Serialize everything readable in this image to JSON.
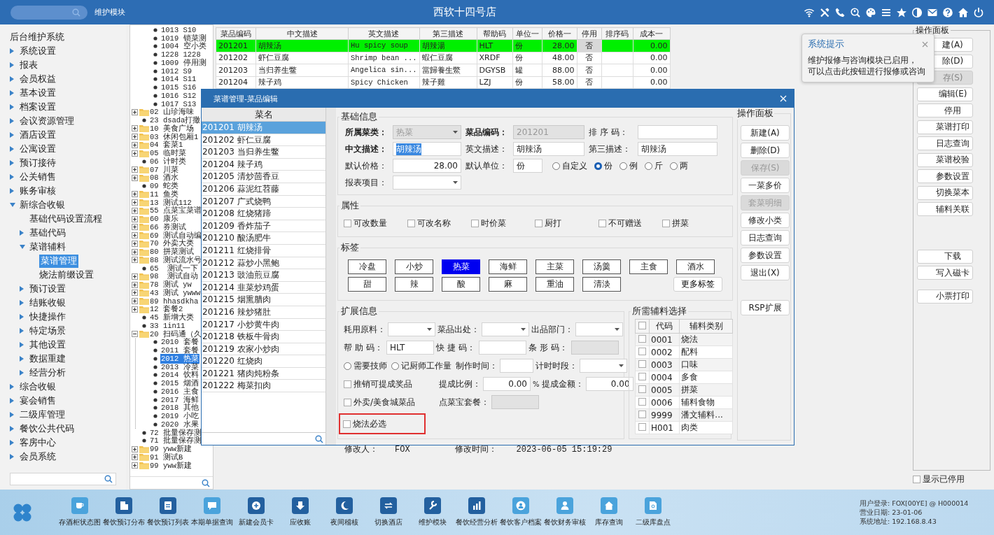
{
  "top_bar": {
    "module_label": "维护模块",
    "title": "西软十四号店"
  },
  "sidebar": {
    "title": "后台维护系统",
    "items": [
      {
        "label": "系统设置",
        "kind": "branch",
        "expanded": false,
        "selected": false
      },
      {
        "label": "报表",
        "kind": "branch",
        "expanded": false,
        "selected": false
      },
      {
        "label": "会员权益",
        "kind": "branch",
        "expanded": false,
        "selected": false
      },
      {
        "label": "基本设置",
        "kind": "branch",
        "expanded": false,
        "selected": false
      },
      {
        "label": "档案设置",
        "kind": "branch",
        "expanded": false,
        "selected": false
      },
      {
        "label": "会议资源管理",
        "kind": "branch",
        "expanded": false,
        "selected": false
      },
      {
        "label": "酒店设置",
        "kind": "branch",
        "expanded": false,
        "selected": false
      },
      {
        "label": "公寓设置",
        "kind": "branch",
        "expanded": false,
        "selected": false
      },
      {
        "label": "预订接待",
        "kind": "branch",
        "expanded": false,
        "selected": false
      },
      {
        "label": "公关销售",
        "kind": "branch",
        "expanded": false,
        "selected": false
      },
      {
        "label": "账务审核",
        "kind": "branch",
        "expanded": false,
        "selected": false
      },
      {
        "label": "新综合收银",
        "kind": "branch",
        "expanded": true,
        "selected": false,
        "children": [
          {
            "label": "基础代码设置流程",
            "kind": "leaf",
            "selected": false
          },
          {
            "label": "基础代码",
            "kind": "branch",
            "expanded": false,
            "selected": false
          },
          {
            "label": "菜谱辅料",
            "kind": "branch",
            "expanded": true,
            "selected": false,
            "children": [
              {
                "label": "菜谱管理",
                "kind": "leaf",
                "selected": true
              },
              {
                "label": "烧法前缀设置",
                "kind": "leaf",
                "selected": false
              }
            ]
          },
          {
            "label": "预订设置",
            "kind": "branch",
            "expanded": false,
            "selected": false
          },
          {
            "label": "结账收银",
            "kind": "branch",
            "expanded": false,
            "selected": false
          },
          {
            "label": "快捷操作",
            "kind": "branch",
            "expanded": false,
            "selected": false
          },
          {
            "label": "特定场景",
            "kind": "branch",
            "expanded": false,
            "selected": false
          },
          {
            "label": "其他设置",
            "kind": "branch",
            "expanded": false,
            "selected": false
          },
          {
            "label": "数据重建",
            "kind": "branch",
            "expanded": false,
            "selected": false
          },
          {
            "label": "经营分析",
            "kind": "branch",
            "expanded": false,
            "selected": false
          }
        ]
      },
      {
        "label": "综合收银",
        "kind": "branch",
        "expanded": false,
        "selected": false
      },
      {
        "label": "宴会销售",
        "kind": "branch",
        "expanded": false,
        "selected": false
      },
      {
        "label": "二级库管理",
        "kind": "branch",
        "expanded": false,
        "selected": false
      },
      {
        "label": "餐饮公共代码",
        "kind": "branch",
        "expanded": false,
        "selected": false
      },
      {
        "label": "客房中心",
        "kind": "branch",
        "expanded": false,
        "selected": false
      },
      {
        "label": "会员系统",
        "kind": "branch",
        "expanded": false,
        "selected": false
      }
    ]
  },
  "tree": {
    "partial_branch": {
      "children": [
        {
          "label": "1013 S10",
          "kind": "leaf",
          "selected": false
        },
        {
          "label": "1019 锁菜测",
          "kind": "leaf",
          "selected": false
        },
        {
          "label": "1004 空小类",
          "kind": "leaf",
          "selected": false
        },
        {
          "label": "1228 1228",
          "kind": "leaf",
          "selected": false
        },
        {
          "label": "1009 停用测",
          "kind": "leaf",
          "selected": false
        },
        {
          "label": "1012 S9",
          "kind": "leaf",
          "selected": false
        },
        {
          "label": "1014 S11",
          "kind": "leaf",
          "selected": false
        },
        {
          "label": "1015 S16",
          "kind": "leaf",
          "selected": false
        },
        {
          "label": "1016 S12",
          "kind": "leaf",
          "selected": false
        },
        {
          "label": "1017 S13",
          "kind": "leaf",
          "selected": false
        }
      ]
    },
    "items": [
      {
        "label": "02 山珍海味",
        "kind": "folder",
        "expanded": false,
        "selected": false
      },
      {
        "label": "23 dsada打撤",
        "kind": "leaf",
        "selected": false
      },
      {
        "label": "10 美食广场",
        "kind": "folder",
        "expanded": false,
        "selected": false
      },
      {
        "label": "03 休闲包厢1",
        "kind": "folder",
        "expanded": false,
        "selected": false
      },
      {
        "label": "04 套菜1",
        "kind": "folder",
        "expanded": false,
        "selected": false
      },
      {
        "label": "05 临时菜",
        "kind": "folder",
        "expanded": false,
        "selected": false
      },
      {
        "label": "06 计时类",
        "kind": "leaf",
        "selected": false
      },
      {
        "label": "07 川菜",
        "kind": "folder",
        "expanded": false,
        "selected": false
      },
      {
        "label": "08 酒水",
        "kind": "folder",
        "expanded": false,
        "selected": false
      },
      {
        "label": "09 蛇类",
        "kind": "leaf",
        "selected": false
      },
      {
        "label": "11 鱼类",
        "kind": "folder",
        "expanded": false,
        "selected": false
      },
      {
        "label": "13 测试112",
        "kind": "folder",
        "expanded": false,
        "selected": false
      },
      {
        "label": "55 点菜宝菜谱",
        "kind": "folder",
        "expanded": false,
        "selected": false
      },
      {
        "label": "60 康乐",
        "kind": "folder",
        "expanded": false,
        "selected": false
      },
      {
        "label": "66 券测试",
        "kind": "folder",
        "expanded": false,
        "selected": false
      },
      {
        "label": "69 测试自动编",
        "kind": "folder",
        "expanded": false,
        "selected": false
      },
      {
        "label": "70 外卖大类",
        "kind": "folder",
        "expanded": false,
        "selected": false
      },
      {
        "label": "80 拼菜测试",
        "kind": "folder",
        "expanded": false,
        "selected": false
      },
      {
        "label": "88 测试流水号",
        "kind": "folder",
        "expanded": false,
        "selected": false
      },
      {
        "label": "65  测试一下",
        "kind": "leaf",
        "selected": false
      },
      {
        "label": "98  测试自动",
        "kind": "folder",
        "expanded": false,
        "selected": false
      },
      {
        "label": "78 测试 yw",
        "kind": "folder",
        "expanded": false,
        "selected": false
      },
      {
        "label": "43 测试 ywww",
        "kind": "folder",
        "expanded": false,
        "selected": false
      },
      {
        "label": "89 hhasdkha",
        "kind": "folder",
        "expanded": false,
        "selected": false
      },
      {
        "label": "12 套餐2",
        "kind": "folder",
        "expanded": false,
        "selected": false
      },
      {
        "label": "45 新增大类",
        "kind": "leaf",
        "selected": false
      },
      {
        "label": "33 1in11",
        "kind": "leaf",
        "selected": false
      },
      {
        "label": "20 扫码通（久",
        "kind": "folder",
        "expanded": true,
        "selected": false,
        "children": [
          {
            "label": "2010 套餐",
            "kind": "leaf",
            "selected": false
          },
          {
            "label": "2011 套餐",
            "kind": "leaf",
            "selected": false
          },
          {
            "label": "2012 热菜",
            "kind": "leaf",
            "selected": true
          },
          {
            "label": "2013 冷菜",
            "kind": "leaf",
            "selected": false
          },
          {
            "label": "2014 饮料",
            "kind": "leaf",
            "selected": false
          },
          {
            "label": "2015 烟酒",
            "kind": "leaf",
            "selected": false
          },
          {
            "label": "2016 主食",
            "kind": "leaf",
            "selected": false
          },
          {
            "label": "2017 海鲜",
            "kind": "leaf",
            "selected": false
          },
          {
            "label": "2018 其他",
            "kind": "leaf",
            "selected": false
          },
          {
            "label": "2019 小吃",
            "kind": "leaf",
            "selected": false
          },
          {
            "label": "2020 水果",
            "kind": "leaf",
            "selected": false
          }
        ]
      },
      {
        "label": "72 批量保存测",
        "kind": "leaf",
        "selected": false
      },
      {
        "label": "71 批量保存测",
        "kind": "leaf",
        "selected": false
      },
      {
        "label": "99 yww新建",
        "kind": "folder",
        "expanded": false,
        "selected": false
      },
      {
        "label": "91 测试B",
        "kind": "folder",
        "expanded": false,
        "selected": false
      },
      {
        "label": "99 yww新建",
        "kind": "folder",
        "expanded": false,
        "selected": false
      }
    ]
  },
  "dish_table": {
    "columns": [
      "菜品编码",
      "中文描述",
      "英文描述",
      "第三描述",
      "帮助码",
      "单位一",
      "价格一",
      "停用",
      "排序码",
      "成本一"
    ],
    "rows": [
      {
        "selected": true,
        "cells": [
          "201201",
          "胡辣汤",
          "Hu spicy soup",
          "胡辣湯",
          "HLT",
          "份",
          "28.00",
          "否",
          "",
          "0.00"
        ]
      },
      {
        "selected": false,
        "cells": [
          "201202",
          "虾仁豆腐",
          "Shrimp bean ...",
          "蝦仁豆腐",
          "XRDF",
          "份",
          "48.00",
          "否",
          "",
          "0.00"
        ]
      },
      {
        "selected": false,
        "cells": [
          "201203",
          "当归养生鳖",
          "Angelica sin...",
          "當歸養生鱉",
          "DGYSB",
          "罐",
          "88.00",
          "否",
          "",
          "0.00"
        ]
      },
      {
        "selected": false,
        "cells": [
          "201204",
          "辣子鸡",
          "Spicy Chicken",
          "辣子雞",
          "LZJ",
          "份",
          "58.00",
          "否",
          "",
          "0.00"
        ]
      }
    ]
  },
  "tooltip": {
    "title": "系统提示",
    "lines": [
      "维护报修与咨询模块已启用，",
      "可以点击此按钮进行报修或咨询"
    ]
  },
  "operation_panel": {
    "title": "操作面板",
    "groups": [
      {
        "buttons": [
          {
            "label": "建(A)",
            "disabled": false
          },
          {
            "label": "除(D)",
            "disabled": false
          },
          {
            "label": "存(S)",
            "disabled": true
          },
          {
            "label": "编辑(E)",
            "disabled": false
          },
          {
            "label": "停用",
            "disabled": false
          },
          {
            "label": "菜谱打印",
            "disabled": false
          },
          {
            "label": "日志查询",
            "disabled": false
          },
          {
            "label": "菜谱校验",
            "disabled": false
          },
          {
            "label": "参数设置",
            "disabled": false
          },
          {
            "label": "切换菜本",
            "disabled": false
          },
          {
            "label": "辅料关联",
            "disabled": false
          }
        ]
      },
      {
        "buttons": [
          {
            "label": "下载",
            "disabled": false
          },
          {
            "label": "写入磁卡",
            "disabled": false
          }
        ]
      },
      {
        "buttons": [
          {
            "label": "小票打印",
            "disabled": false
          }
        ]
      }
    ],
    "show_disabled": {
      "label": "显示已停用",
      "checked": false
    }
  },
  "dialog": {
    "title": "菜谱管理-菜品编辑",
    "dish_list": {
      "header": "菜名",
      "rows": [
        {
          "label": "201201 胡辣汤",
          "selected": true
        },
        {
          "label": "201202 虾仁豆腐",
          "selected": false
        },
        {
          "label": "201203 当归养生鳖",
          "selected": false
        },
        {
          "label": "201204 辣子鸡",
          "selected": false
        },
        {
          "label": "201205 清炒茴香豆",
          "selected": false
        },
        {
          "label": "201206 蒜泥红苕藤",
          "selected": false
        },
        {
          "label": "201207 广式烧鸭",
          "selected": false
        },
        {
          "label": "201208 红烧猪蹄",
          "selected": false
        },
        {
          "label": "201209 香炸茄子",
          "selected": false
        },
        {
          "label": "201210 酸汤肥牛",
          "selected": false
        },
        {
          "label": "201211 红烧排骨",
          "selected": false
        },
        {
          "label": "201212 蒜炒小黑鲍",
          "selected": false
        },
        {
          "label": "201213 豉油煎豆腐",
          "selected": false
        },
        {
          "label": "201214 韭菜炒鸡蛋",
          "selected": false
        },
        {
          "label": "201215 烟熏腊肉",
          "selected": false
        },
        {
          "label": "201216 辣炒猪肚",
          "selected": false
        },
        {
          "label": "201217 小炒黄牛肉",
          "selected": false
        },
        {
          "label": "201218 铁板牛骨肉",
          "selected": false
        },
        {
          "label": "201219 农家小炒肉",
          "selected": false
        },
        {
          "label": "201220 红烧肉",
          "selected": false
        },
        {
          "label": "201221 猪肉炖粉条",
          "selected": false
        },
        {
          "label": "201222 梅菜扣肉",
          "selected": false
        }
      ]
    },
    "basic_info": {
      "title": "基础信息",
      "rows": [
        [
          {
            "kind": "label",
            "text": "所属菜类：",
            "bold": true
          },
          {
            "kind": "select",
            "value": "热菜",
            "disabled": true
          },
          {
            "kind": "label",
            "text": "菜品编码：",
            "bold": true
          },
          {
            "kind": "text",
            "value": "201201",
            "disabled": true
          },
          {
            "kind": "label",
            "text": "排 序 码：",
            "bold": false
          },
          {
            "kind": "text",
            "disabled": false
          }
        ],
        [
          {
            "kind": "label",
            "text": "中文描述：",
            "bold": true
          },
          {
            "kind": "text",
            "value": "胡辣汤",
            "disabled": false,
            "text_selected": true
          },
          {
            "kind": "label",
            "text": "英文描述：",
            "bold": false
          },
          {
            "kind": "text",
            "value": "胡辣汤",
            "disabled": false
          },
          {
            "kind": "label",
            "text": "第三描述：",
            "bold": false
          },
          {
            "kind": "text",
            "value": "胡辣汤",
            "disabled": false
          }
        ],
        [
          {
            "kind": "label",
            "text": "默认价格：",
            "bold": false
          },
          {
            "kind": "number",
            "value": "28.00",
            "disabled": false
          },
          {
            "kind": "label",
            "text": "默认单位：",
            "bold": false
          },
          {
            "kind": "unit_group",
            "value": "份",
            "disabled": false,
            "options": [
              {
                "label": "自定义",
                "selected": false
              },
              {
                "label": "份",
                "selected": true
              },
              {
                "label": "例",
                "selected": false
              },
              {
                "label": "斤",
                "selected": false
              },
              {
                "label": "两",
                "selected": false
              }
            ]
          }
        ],
        [
          {
            "kind": "label",
            "text": "报表项目：",
            "bold": false
          },
          {
            "kind": "select",
            "disabled": false
          }
        ]
      ]
    },
    "attributes": {
      "title": "属性",
      "options": [
        {
          "label": "可改数量",
          "checked": false
        },
        {
          "label": "可改名称",
          "checked": false
        },
        {
          "label": "时价菜",
          "checked": false
        },
        {
          "label": "厨打",
          "checked": false
        },
        {
          "label": "不可赠送",
          "checked": false
        },
        {
          "label": "拼菜",
          "checked": false
        }
      ]
    },
    "tags": {
      "title": "标签",
      "rows": [
        [
          {
            "label": "冷盘",
            "selected": false
          },
          {
            "label": "小炒",
            "selected": false
          },
          {
            "label": "热菜",
            "selected": true
          },
          {
            "label": "海鲜",
            "selected": false
          },
          {
            "label": "主菜",
            "selected": false
          },
          {
            "label": "汤羹",
            "selected": false
          },
          {
            "label": "主食",
            "selected": false
          },
          {
            "label": "酒水",
            "selected": false
          }
        ],
        [
          {
            "label": "甜",
            "selected": false
          },
          {
            "label": "辣",
            "selected": false
          },
          {
            "label": "酸",
            "selected": false
          },
          {
            "label": "麻",
            "selected": false
          },
          {
            "label": "重油",
            "selected": false
          },
          {
            "label": "清淡",
            "selected": false
          }
        ]
      ],
      "more_button": "更多标签"
    },
    "extended_info": {
      "title": "扩展信息",
      "rows": [
        [
          {
            "kind": "label",
            "text": "耗用原料："
          },
          {
            "kind": "select",
            "disabled": false
          },
          {
            "kind": "label",
            "text": "菜品出处："
          },
          {
            "kind": "select",
            "disabled": false
          },
          {
            "kind": "label",
            "text": "出品部门："
          },
          {
            "kind": "select",
            "disabled": false
          }
        ],
        [
          {
            "kind": "label",
            "text": "帮 助 码："
          },
          {
            "kind": "text",
            "value": "HLT",
            "disabled": false
          },
          {
            "kind": "label",
            "text": "快 捷 码："
          },
          {
            "kind": "text",
            "disabled": false
          },
          {
            "kind": "label",
            "text": "条 形 码："
          },
          {
            "kind": "text",
            "disabled": true
          }
        ],
        [
          {
            "kind": "radio",
            "label": "需要技师",
            "selected": false
          },
          {
            "kind": "radio",
            "label": "记厨师工作量",
            "selected": false
          },
          {
            "kind": "label",
            "text": "制作时间："
          },
          {
            "kind": "text",
            "disabled": false
          },
          {
            "kind": "label",
            "text": "计时时段："
          },
          {
            "kind": "select",
            "disabled": false
          }
        ],
        [
          {
            "kind": "checkbox",
            "label": "推销可提成奖品",
            "checked": false,
            "highlighted": false
          },
          {
            "kind": "label",
            "text": "提成比例："
          },
          {
            "kind": "number",
            "value": "0.00",
            "disabled": false
          },
          {
            "kind": "suffix",
            "text": "%"
          },
          {
            "kind": "label",
            "text": "提成金额："
          },
          {
            "kind": "number",
            "value": "0.00",
            "disabled": false
          }
        ],
        [
          {
            "kind": "checkbox",
            "label": "外卖/美食城菜品",
            "checked": false,
            "highlighted": false
          },
          {
            "kind": "label",
            "text": "点菜宝套餐："
          },
          {
            "kind": "text",
            "disabled": true
          }
        ],
        [
          {
            "kind": "checkbox",
            "label": "烧法必选",
            "checked": false,
            "highlighted": true
          }
        ]
      ]
    },
    "accessories": {
      "title": "所需辅料选择",
      "header_checked": false,
      "columns": [
        "代码",
        "辅料类别"
      ],
      "rows": [
        {
          "checked": false,
          "cells": [
            "0001",
            "烧法"
          ]
        },
        {
          "checked": false,
          "cells": [
            "0002",
            "配料"
          ]
        },
        {
          "checked": false,
          "cells": [
            "0003",
            "口味"
          ]
        },
        {
          "checked": false,
          "cells": [
            "0004",
            "多食"
          ]
        },
        {
          "checked": false,
          "cells": [
            "0005",
            "拼菜"
          ]
        },
        {
          "checked": false,
          "cells": [
            "0006",
            "辅料食物"
          ]
        },
        {
          "checked": false,
          "cells": [
            "9999",
            "潘文辅料..."
          ]
        },
        {
          "checked": false,
          "cells": [
            "H001",
            "肉类"
          ]
        }
      ]
    },
    "footer": {
      "modifier_label": "修改人：",
      "modifier": "FOX",
      "time_label": "修改时间：",
      "time": "2023-06-05 15:19:29"
    },
    "operations": {
      "title": "操作面板",
      "groups": [
        {
          "buttons": [
            {
              "label": "新建(A)",
              "disabled": false
            },
            {
              "label": "删除(D)",
              "disabled": false
            },
            {
              "label": "保存(S)",
              "disabled": true
            },
            {
              "label": "一菜多价",
              "disabled": false
            },
            {
              "label": "套菜明细",
              "disabled": true
            },
            {
              "label": "修改小类",
              "disabled": false
            },
            {
              "label": "日志查询",
              "disabled": false
            },
            {
              "label": "参数设置",
              "disabled": false
            },
            {
              "label": "退出(X)",
              "disabled": false
            }
          ]
        },
        {
          "buttons": [
            {
              "label": "RSP扩展",
              "disabled": false
            }
          ]
        }
      ]
    }
  },
  "taskbar": {
    "apps": [
      "存酒柜状态图",
      "餐饮预订分布",
      "餐饮预订列表",
      "本期单据查询",
      "新建会员卡",
      "应收账",
      "夜间稽核",
      "切换酒店",
      "维护模块",
      "餐饮经营分析",
      "餐饮客户档案",
      "餐饮财务审核",
      "库存查询",
      "二级库盘点"
    ],
    "info": [
      "用户登录: FOX[00YE] @ H000014",
      "营业日期: 23-01-06",
      "系统地址: 192.168.8.43"
    ]
  }
}
